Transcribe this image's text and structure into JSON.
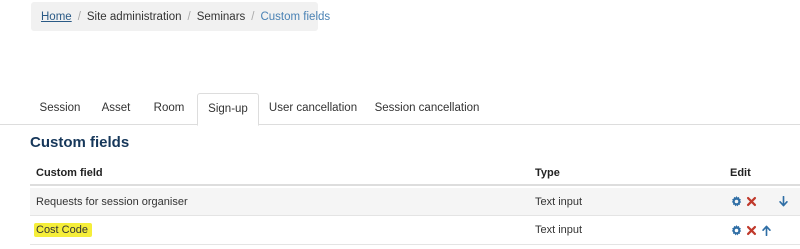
{
  "breadcrumb": {
    "items": [
      "Home",
      "Site administration",
      "Seminars",
      "Custom fields"
    ],
    "separator": "/"
  },
  "tabs": [
    {
      "label": "Session",
      "active": false
    },
    {
      "label": "Asset",
      "active": false
    },
    {
      "label": "Room",
      "active": false
    },
    {
      "label": "Sign-up",
      "active": true
    },
    {
      "label": "User cancellation",
      "active": false
    },
    {
      "label": "Session cancellation",
      "active": false
    }
  ],
  "section": {
    "title": "Custom fields"
  },
  "table": {
    "headers": {
      "name": "Custom field",
      "type": "Type",
      "edit": "Edit"
    },
    "rows": [
      {
        "name": "Requests for session organiser",
        "type": "Text input",
        "actions": [
          "gear-icon",
          "delete-icon",
          "arrow-down-icon"
        ]
      },
      {
        "name": "Cost Code",
        "type": "Text input",
        "actions": [
          "gear-icon",
          "delete-icon",
          "arrow-up-icon"
        ],
        "highlighted": true
      }
    ]
  },
  "colors": {
    "link": "#2a5a86",
    "heading": "#16375a",
    "gear": "#2f6ea5",
    "delete": "#c0392b",
    "highlight": "#f5ee3a"
  }
}
